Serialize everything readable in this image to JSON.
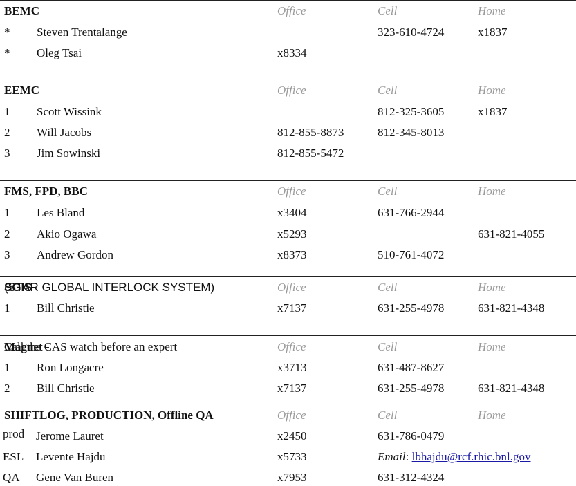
{
  "header_labels": {
    "office": "Office",
    "cell": "Cell",
    "home": "Home"
  },
  "bemc": {
    "title": "BEMC",
    "rows": [
      {
        "idx": "*",
        "name": "Steven Trentalange",
        "office": "",
        "cell": "323-610-4724",
        "home": "x1837"
      },
      {
        "idx": "*",
        "name": "Oleg Tsai",
        "office": "x8334",
        "cell": "",
        "home": ""
      }
    ]
  },
  "eemc": {
    "title": "EEMC",
    "rows": [
      {
        "idx": "1",
        "name": "Scott Wissink",
        "office": "",
        "cell": "812-325-3605",
        "home": "x1837"
      },
      {
        "idx": "2",
        "name": "Will Jacobs",
        "office": "812-855-8873",
        "cell": "812-345-8013",
        "home": ""
      },
      {
        "idx": "3",
        "name": "Jim Sowinski",
        "office": "812-855-5472",
        "cell": "",
        "home": ""
      }
    ]
  },
  "fms": {
    "title": "FMS, FPD, BBC",
    "rows": [
      {
        "idx": "1",
        "name": "Les Bland",
        "office": "x3404",
        "cell": "631-766-2944",
        "home": ""
      },
      {
        "idx": "2",
        "name": "Akio Ogawa",
        "office": "x5293",
        "cell": "",
        "home": "631-821-4055"
      },
      {
        "idx": "3",
        "name": "Andrew Gordon",
        "office": "x8373",
        "cell": "510-761-4072",
        "home": ""
      }
    ]
  },
  "sgis": {
    "title": "SGIS",
    "subtitle": "(STAR GLOBAL INTERLOCK SYSTEM)",
    "rows": [
      {
        "idx": "1",
        "name": "Bill Christie",
        "office": "x7137",
        "cell": "631-255-4978",
        "home": "631-821-4348"
      }
    ]
  },
  "magnet": {
    "title": "Magnet -",
    "subtitle": "Call the CAS watch before an expert",
    "rows": [
      {
        "idx": "1",
        "name": "Ron Longacre",
        "office": "x3713",
        "cell": "631-487-8627",
        "home": ""
      },
      {
        "idx": "2",
        "name": "Bill Christie",
        "office": "x7137",
        "cell": "631-255-4978",
        "home": "631-821-4348"
      }
    ]
  },
  "shiftlog": {
    "title": "SHIFTLOG, PRODUCTION, Offline QA",
    "rows": [
      {
        "idx": "prod",
        "name": "Jerome Lauret",
        "office": "x2450",
        "cell": "631-786-0479",
        "home": ""
      },
      {
        "idx": "ESL",
        "name": "Levente Hajdu",
        "office": "x5733",
        "email_label": "Email",
        "email": "lbhajdu@rcf.rhic.bnl.gov"
      },
      {
        "idx": "QA",
        "name": "Gene Van Buren",
        "office": "x7953",
        "cell": "631-312-4324",
        "home": ""
      }
    ]
  }
}
